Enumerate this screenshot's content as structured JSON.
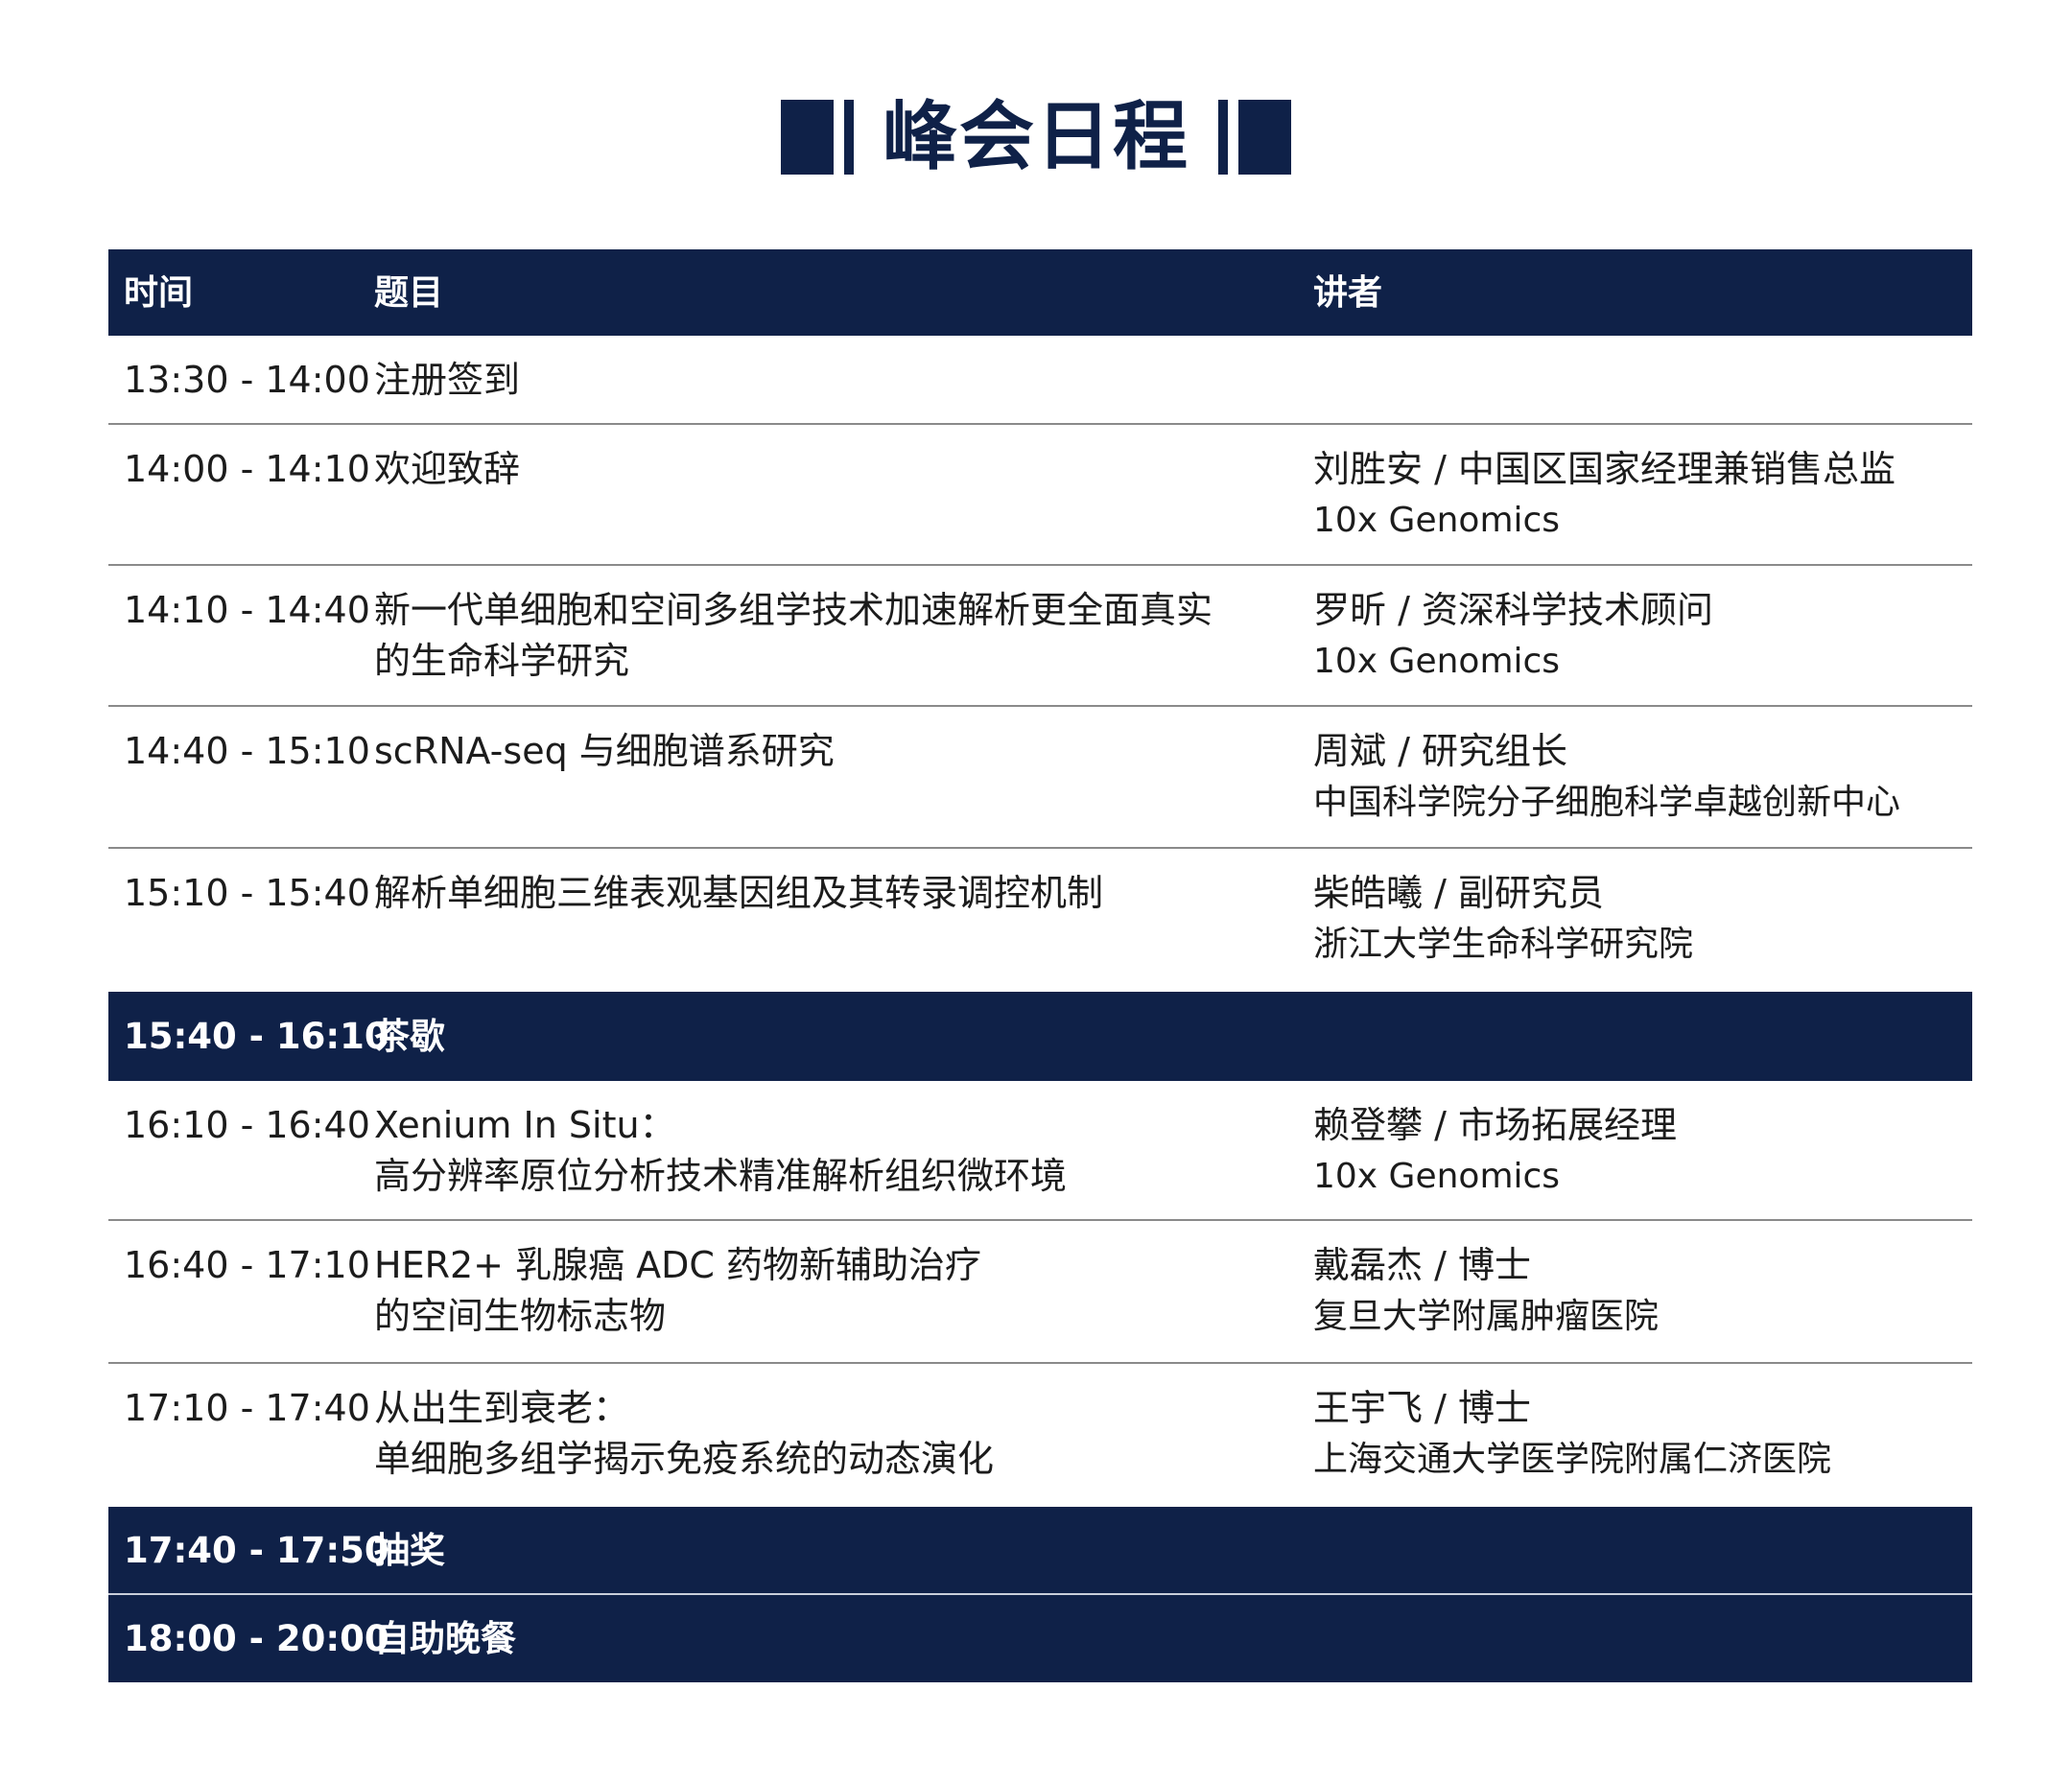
{
  "title": "峰会日程",
  "colors": {
    "brand_navy": "#0f2148",
    "divider": "#8a8a8a"
  },
  "header": {
    "time": "时间",
    "topic": "题目",
    "speaker": "讲者"
  },
  "rows": [
    {
      "time": "13:30 - 14:00",
      "topic": [
        "注册签到"
      ],
      "speaker": "",
      "org": ""
    },
    {
      "time": "14:00 - 14:10",
      "topic": [
        "欢迎致辞"
      ],
      "speaker": "刘胜安 / 中国区国家经理兼销售总监",
      "org": "10x Genomics"
    },
    {
      "time": "14:10 - 14:40",
      "topic": [
        "新一代单细胞和空间多组学技术加速解析更全面真实",
        "的生命科学研究"
      ],
      "speaker": "罗昕 / 资深科学技术顾问",
      "org": "10x Genomics"
    },
    {
      "time": "14:40 - 15:10",
      "topic": [
        "scRNA-seq 与细胞谱系研究"
      ],
      "speaker": "周斌 / 研究组长",
      "org": "中国科学院分子细胞科学卓越创新中心"
    },
    {
      "time": "15:10 - 15:40",
      "topic": [
        "解析单细胞三维表观基因组及其转录调控机制"
      ],
      "speaker": "柴皓曦 / 副研究员",
      "org": "浙江大学生命科学研究院"
    },
    {
      "time": "15:40 - 16:10",
      "topic": [
        "茶歇"
      ],
      "speaker": "",
      "org": ""
    },
    {
      "time": "16:10 - 16:40",
      "topic": [
        "Xenium In Situ：",
        "高分辨率原位分析技术精准解析组织微环境"
      ],
      "speaker": "赖登攀 / 市场拓展经理",
      "org": "10x Genomics"
    },
    {
      "time": "16:40 - 17:10",
      "topic": [
        "HER2+ 乳腺癌 ADC 药物新辅助治疗",
        "的空间生物标志物"
      ],
      "speaker": "戴磊杰 / 博士",
      "org": "复旦大学附属肿瘤医院"
    },
    {
      "time": "17:10 - 17:40",
      "topic": [
        "从出生到衰老：",
        "单细胞多组学揭示免疫系统的动态演化"
      ],
      "speaker": "王宇飞 / 博士",
      "org": "上海交通大学医学院附属仁济医院"
    },
    {
      "time": "17:40 - 17:50",
      "topic": [
        "抽奖"
      ],
      "speaker": "",
      "org": ""
    },
    {
      "time": "18:00 - 20:00",
      "topic": [
        "自助晚餐"
      ],
      "speaker": "",
      "org": ""
    }
  ]
}
